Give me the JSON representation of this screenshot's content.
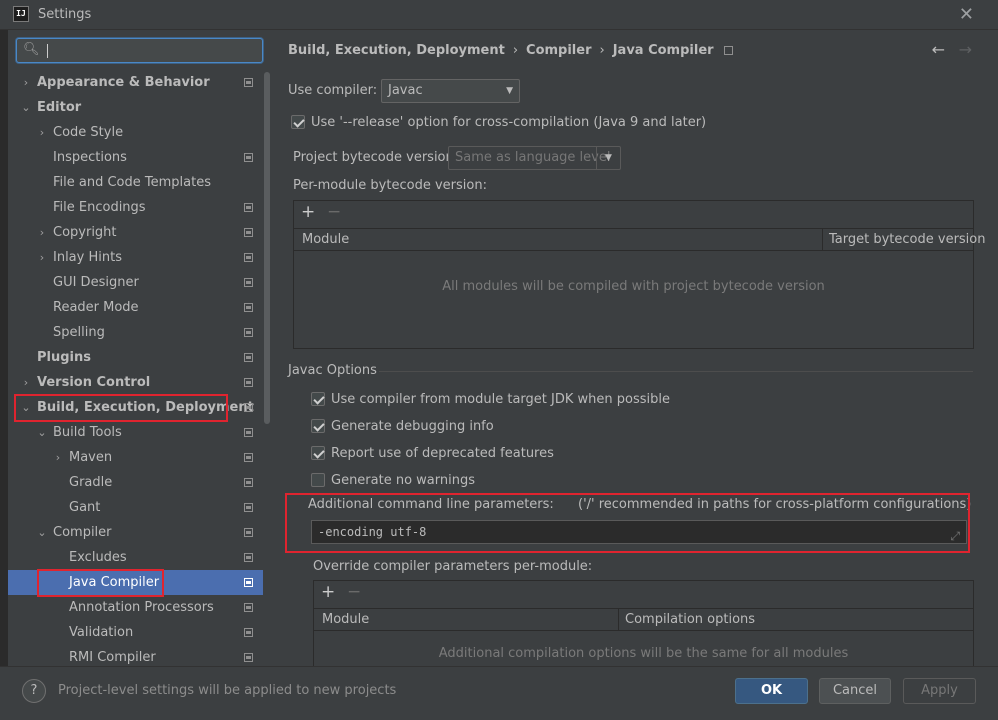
{
  "window": {
    "title": "Settings",
    "app_icon": "IJ"
  },
  "search": {
    "placeholder": ""
  },
  "sidebar": {
    "items": [
      {
        "label": "Appearance & Behavior",
        "arrow": "›",
        "bold": true,
        "level": 0,
        "project": true
      },
      {
        "label": "Editor",
        "arrow": "⌄",
        "bold": true,
        "level": 0,
        "project": false
      },
      {
        "label": "Code Style",
        "arrow": "›",
        "bold": false,
        "level": 1,
        "project": false
      },
      {
        "label": "Inspections",
        "arrow": "",
        "bold": false,
        "level": 1,
        "project": true
      },
      {
        "label": "File and Code Templates",
        "arrow": "",
        "bold": false,
        "level": 1,
        "project": false
      },
      {
        "label": "File Encodings",
        "arrow": "",
        "bold": false,
        "level": 1,
        "project": true
      },
      {
        "label": "Copyright",
        "arrow": "›",
        "bold": false,
        "level": 1,
        "project": true
      },
      {
        "label": "Inlay Hints",
        "arrow": "›",
        "bold": false,
        "level": 1,
        "project": true
      },
      {
        "label": "GUI Designer",
        "arrow": "",
        "bold": false,
        "level": 1,
        "project": true
      },
      {
        "label": "Reader Mode",
        "arrow": "",
        "bold": false,
        "level": 1,
        "project": true
      },
      {
        "label": "Spelling",
        "arrow": "",
        "bold": false,
        "level": 1,
        "project": true
      },
      {
        "label": "Plugins",
        "arrow": "",
        "bold": true,
        "level": 0,
        "project": true
      },
      {
        "label": "Version Control",
        "arrow": "›",
        "bold": true,
        "level": 0,
        "project": true
      },
      {
        "label": "Build, Execution, Deployment",
        "arrow": "⌄",
        "bold": true,
        "level": 0,
        "project": true
      },
      {
        "label": "Build Tools",
        "arrow": "⌄",
        "bold": false,
        "level": 1,
        "project": true
      },
      {
        "label": "Maven",
        "arrow": "›",
        "bold": false,
        "level": 2,
        "project": true
      },
      {
        "label": "Gradle",
        "arrow": "",
        "bold": false,
        "level": 2,
        "project": true
      },
      {
        "label": "Gant",
        "arrow": "",
        "bold": false,
        "level": 2,
        "project": true
      },
      {
        "label": "Compiler",
        "arrow": "⌄",
        "bold": false,
        "level": 1,
        "project": true
      },
      {
        "label": "Excludes",
        "arrow": "",
        "bold": false,
        "level": 2,
        "project": true
      },
      {
        "label": "Java Compiler",
        "arrow": "",
        "bold": false,
        "level": 2,
        "project": true,
        "selected": true
      },
      {
        "label": "Annotation Processors",
        "arrow": "",
        "bold": false,
        "level": 2,
        "project": true
      },
      {
        "label": "Validation",
        "arrow": "",
        "bold": false,
        "level": 2,
        "project": true
      },
      {
        "label": "RMI Compiler",
        "arrow": "",
        "bold": false,
        "level": 2,
        "project": true
      }
    ]
  },
  "breadcrumb": {
    "part1": "Build, Execution, Deployment",
    "part2": "Compiler",
    "part3": "Java Compiler",
    "separator": "›"
  },
  "nav": {
    "back": "←",
    "forward": "→"
  },
  "form": {
    "use_compiler_label": "Use compiler:",
    "use_compiler_value": "Javac",
    "release_option_label": "Use '--release' option for cross-compilation (Java 9 and later)",
    "release_option_checked": true,
    "bytecode_label": "Project bytecode version:",
    "bytecode_placeholder": "Same as language level",
    "per_module_label": "Per-module bytecode version:",
    "per_module_table": {
      "columns": [
        "Module",
        "Target bytecode version"
      ],
      "empty_text": "All modules will be compiled with project bytecode version"
    },
    "javac_section_title": "Javac Options",
    "javac_options": [
      {
        "label": "Use compiler from module target JDK when possible",
        "checked": true
      },
      {
        "label": "Generate debugging info",
        "checked": true
      },
      {
        "label": "Report use of deprecated features",
        "checked": true
      },
      {
        "label": "Generate no warnings",
        "checked": false
      }
    ],
    "additional_params_label": "Additional command line parameters:",
    "additional_params_hint": "('/' recommended in paths for cross-platform configurations)",
    "additional_params_value": "-encoding utf-8",
    "override_label": "Override compiler parameters per-module:",
    "override_table": {
      "columns": [
        "Module",
        "Compilation options"
      ],
      "empty_text": "Additional compilation options will be the same for all modules"
    }
  },
  "footer": {
    "help": "?",
    "note": "Project-level settings will be applied to new projects",
    "ok": "OK",
    "cancel": "Cancel",
    "apply": "Apply"
  },
  "colors": {
    "accent": "#4b6eaf",
    "highlight_box": "#e0242f",
    "ok_button": "#365880"
  }
}
